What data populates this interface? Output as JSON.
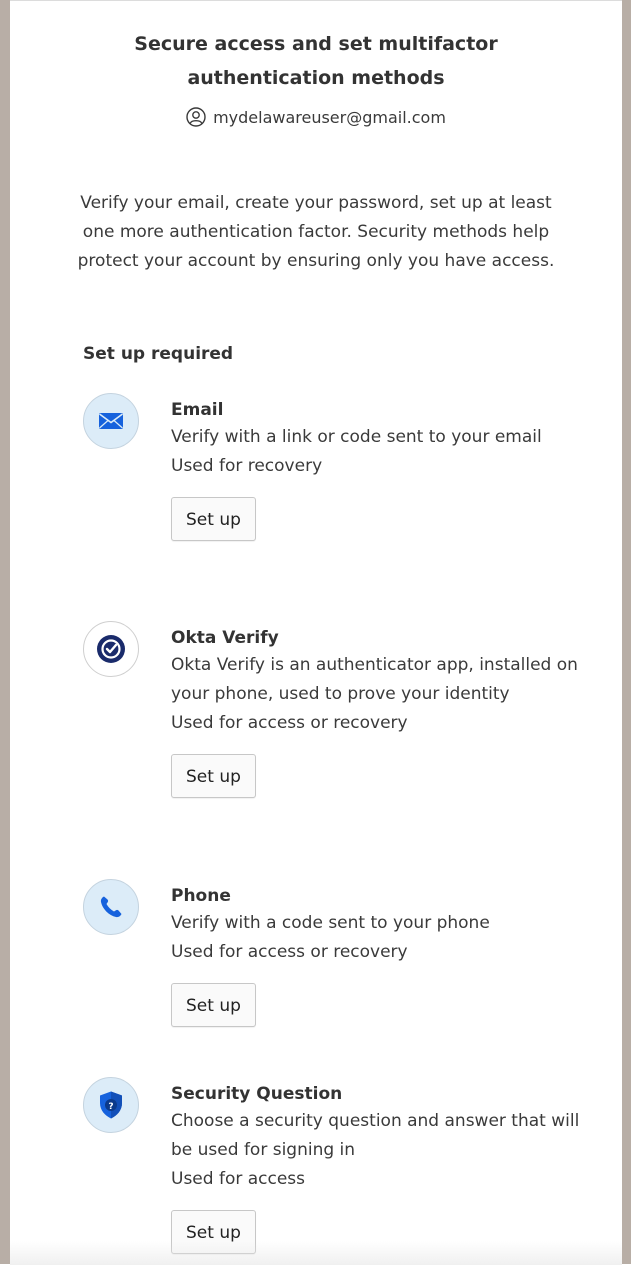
{
  "header": {
    "title": "Secure access and set multifactor authentication methods",
    "username": "mydelawareuser@gmail.com"
  },
  "intro": "Verify your email, create your password, set up at least one more authentication factor. Security methods help protect your account by ensuring only you have access.",
  "section_title": "Set up required",
  "authenticators": [
    {
      "icon": "envelope-icon",
      "name": "Email",
      "description": "Verify with a link or code sent to your email",
      "usage": "Used for recovery",
      "button": "Set up"
    },
    {
      "icon": "okta-verify-icon",
      "name": "Okta Verify",
      "description": "Okta Verify is an authenticator app, installed on your phone, used to prove your identity",
      "usage": "Used for access or recovery",
      "button": "Set up"
    },
    {
      "icon": "phone-icon",
      "name": "Phone",
      "description": "Verify with a code sent to your phone",
      "usage": "Used for access or recovery",
      "button": "Set up"
    },
    {
      "icon": "shield-question-icon",
      "name": "Security Question",
      "description": "Choose a security question and answer that will be used for signing in",
      "usage": "Used for access",
      "button": "Set up"
    }
  ],
  "colors": {
    "accent": "#1662dd",
    "icon_bg": "#dcecf8",
    "okta_navy": "#1a2b6b",
    "side_bar": "#b8aea6"
  }
}
